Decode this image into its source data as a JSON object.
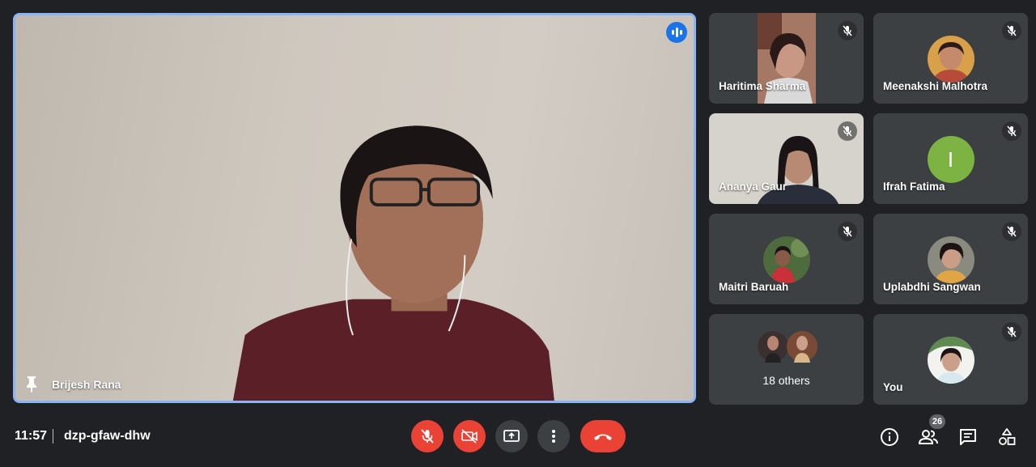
{
  "main": {
    "speaker_name": "Brijesh Rana"
  },
  "tiles": [
    {
      "name": "Haritima Sharma"
    },
    {
      "name": "Meenakshi Malhotra"
    },
    {
      "name": "Ananya Gaur"
    },
    {
      "name": "Ifrah Fatima",
      "initial": "I"
    },
    {
      "name": "Maitri Baruah"
    },
    {
      "name": "Uplabdhi Sangwan"
    },
    {
      "others_label": "18 others"
    },
    {
      "name": "You"
    }
  ],
  "bottom_bar": {
    "time": "11:57",
    "meeting_code": "dzp-gfaw-dhw",
    "participant_count": "26"
  },
  "colors": {
    "background": "#202124",
    "tile": "#3c4043",
    "active_border": "#8ab4f8",
    "danger": "#ea4335",
    "initial_avatar": "#7cb342"
  },
  "icons": [
    "speaking-icon",
    "pin-icon",
    "mic-off-icon",
    "camera-off-icon",
    "present-screen-icon",
    "more-options-icon",
    "end-call-icon",
    "info-icon",
    "people-icon",
    "chat-icon",
    "activities-icon"
  ]
}
